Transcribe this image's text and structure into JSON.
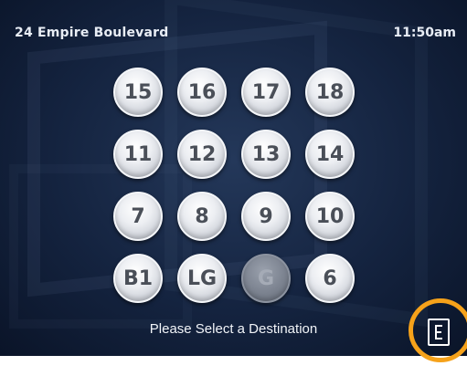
{
  "header": {
    "address": "24 Empire Boulevard",
    "time": "11:50am"
  },
  "keypad": {
    "rows": [
      [
        {
          "label": "15",
          "state": "enabled"
        },
        {
          "label": "16",
          "state": "enabled"
        },
        {
          "label": "17",
          "state": "enabled"
        },
        {
          "label": "18",
          "state": "enabled"
        }
      ],
      [
        {
          "label": "11",
          "state": "enabled"
        },
        {
          "label": "12",
          "state": "enabled"
        },
        {
          "label": "13",
          "state": "enabled"
        },
        {
          "label": "14",
          "state": "enabled"
        }
      ],
      [
        {
          "label": "7",
          "state": "enabled"
        },
        {
          "label": "8",
          "state": "enabled"
        },
        {
          "label": "9",
          "state": "enabled"
        },
        {
          "label": "10",
          "state": "enabled"
        }
      ],
      [
        {
          "label": "B1",
          "state": "enabled"
        },
        {
          "label": "LG",
          "state": "enabled"
        },
        {
          "label": "G",
          "state": "disabled"
        },
        {
          "label": "6",
          "state": "enabled"
        }
      ]
    ]
  },
  "footer": {
    "prompt": "Please Select a Destination",
    "exit_icon": "elevator-exit-icon"
  },
  "colors": {
    "background": "#14233f",
    "button_face": "#eceef2",
    "button_text": "#4a4f58",
    "highlight_ring": "#f6a21a"
  }
}
